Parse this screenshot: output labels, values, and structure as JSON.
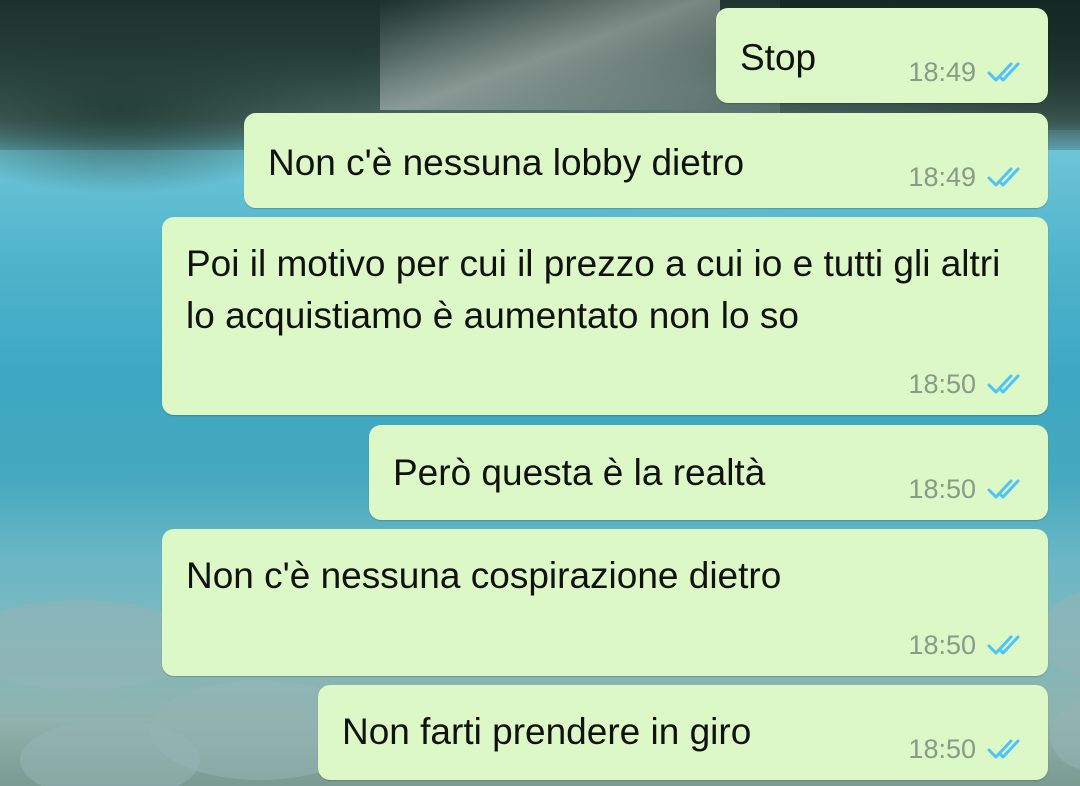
{
  "chat": {
    "messages": [
      {
        "text": "Stop",
        "time": "18:49",
        "status_icon": "double-check-read-icon"
      },
      {
        "text": "Non c'è nessuna lobby dietro",
        "time": "18:49",
        "status_icon": "double-check-read-icon"
      },
      {
        "text": "Poi il motivo per cui il prezzo a cui io e tutti gli altri lo acquistiamo è aumentato non lo so",
        "time": "18:50",
        "status_icon": "double-check-read-icon"
      },
      {
        "text": "Però questa è la realtà",
        "time": "18:50",
        "status_icon": "double-check-read-icon"
      },
      {
        "text": "Non c'è nessuna cospirazione dietro",
        "time": "18:50",
        "status_icon": "double-check-read-icon"
      },
      {
        "text": "Non farti prendere in giro",
        "time": "18:50",
        "status_icon": "double-check-read-icon"
      }
    ]
  },
  "colors": {
    "bubble_outgoing": "#dcf8c6",
    "read_ticks": "#4fc3f7",
    "timestamp": "#8a9a88"
  }
}
